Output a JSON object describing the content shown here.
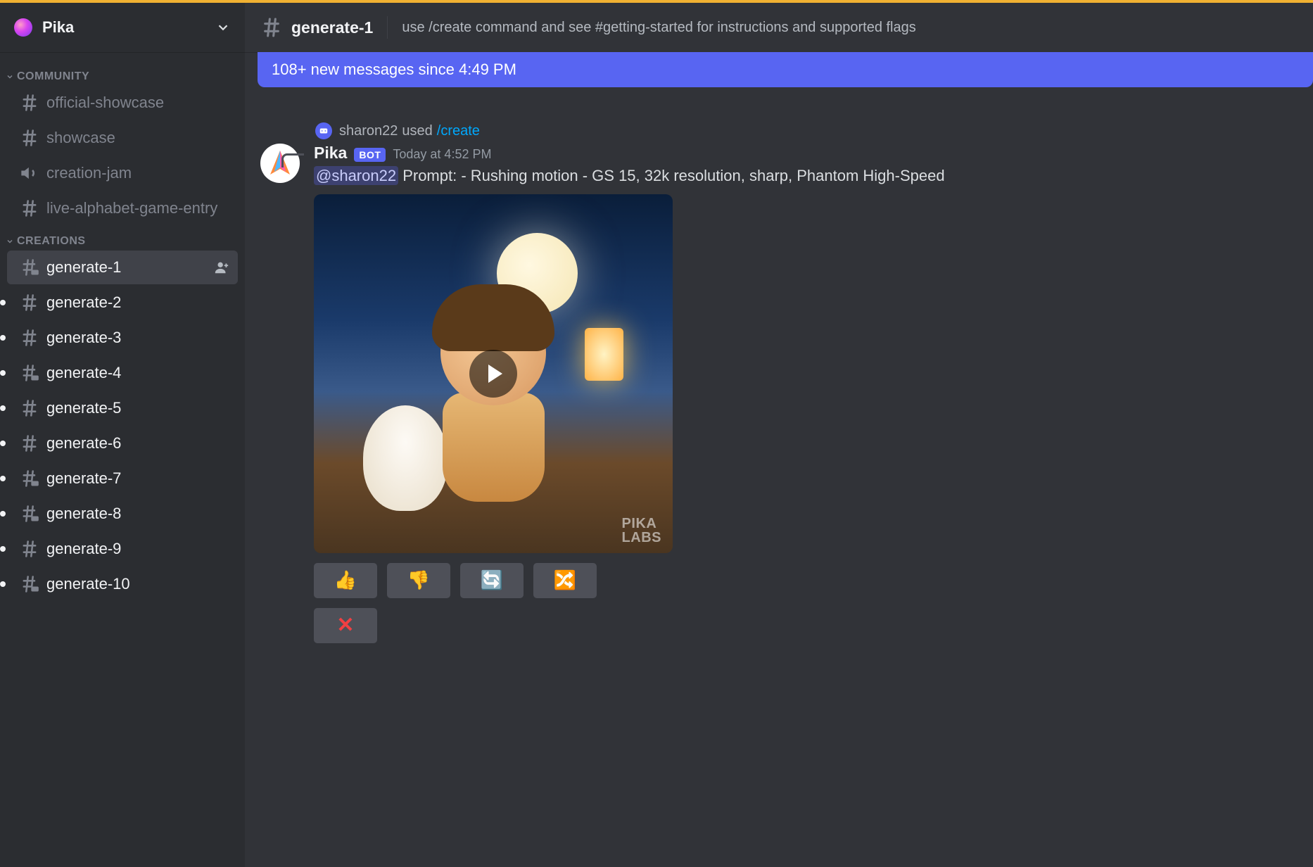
{
  "server": {
    "name": "Pika"
  },
  "sidebar": {
    "categories": [
      {
        "label": "COMMUNITY",
        "channels": [
          {
            "name": "official-showcase",
            "icon": "hash",
            "unread": false,
            "active": false
          },
          {
            "name": "showcase",
            "icon": "hash",
            "unread": false,
            "active": false
          },
          {
            "name": "creation-jam",
            "icon": "voice",
            "unread": false,
            "active": false
          },
          {
            "name": "live-alphabet-game-entry",
            "icon": "hash",
            "unread": false,
            "active": false
          }
        ]
      },
      {
        "label": "CREATIONS",
        "channels": [
          {
            "name": "generate-1",
            "icon": "hash-chat",
            "unread": false,
            "active": true,
            "addUser": true
          },
          {
            "name": "generate-2",
            "icon": "hash",
            "unread": true,
            "active": false
          },
          {
            "name": "generate-3",
            "icon": "hash",
            "unread": true,
            "active": false
          },
          {
            "name": "generate-4",
            "icon": "hash-chat",
            "unread": true,
            "active": false
          },
          {
            "name": "generate-5",
            "icon": "hash",
            "unread": true,
            "active": false
          },
          {
            "name": "generate-6",
            "icon": "hash",
            "unread": true,
            "active": false
          },
          {
            "name": "generate-7",
            "icon": "hash-chat",
            "unread": true,
            "active": false
          },
          {
            "name": "generate-8",
            "icon": "hash-chat",
            "unread": true,
            "active": false
          },
          {
            "name": "generate-9",
            "icon": "hash",
            "unread": true,
            "active": false
          },
          {
            "name": "generate-10",
            "icon": "hash-chat",
            "unread": true,
            "active": false
          }
        ]
      }
    ]
  },
  "header": {
    "channel": "generate-1",
    "topic": "use /create command and see #getting-started for instructions and supported flags"
  },
  "newMessagesBar": "108+ new messages since 4:49 PM",
  "message": {
    "reply": {
      "user": "sharon22",
      "used": "used",
      "command": "/create"
    },
    "author": "Pika",
    "botTag": "BOT",
    "timestamp": "Today at 4:52 PM",
    "mention": "@sharon22",
    "text": " Prompt: - Rushing motion - GS 15, 32k resolution, sharp, Phantom High-Speed",
    "watermark1": "PIKA",
    "watermark2": "LABS",
    "actions": {
      "thumbsUp": "👍",
      "thumbsDown": "👎",
      "refresh": "🔄",
      "shuffle": "🔀",
      "cancel": "✕"
    }
  }
}
